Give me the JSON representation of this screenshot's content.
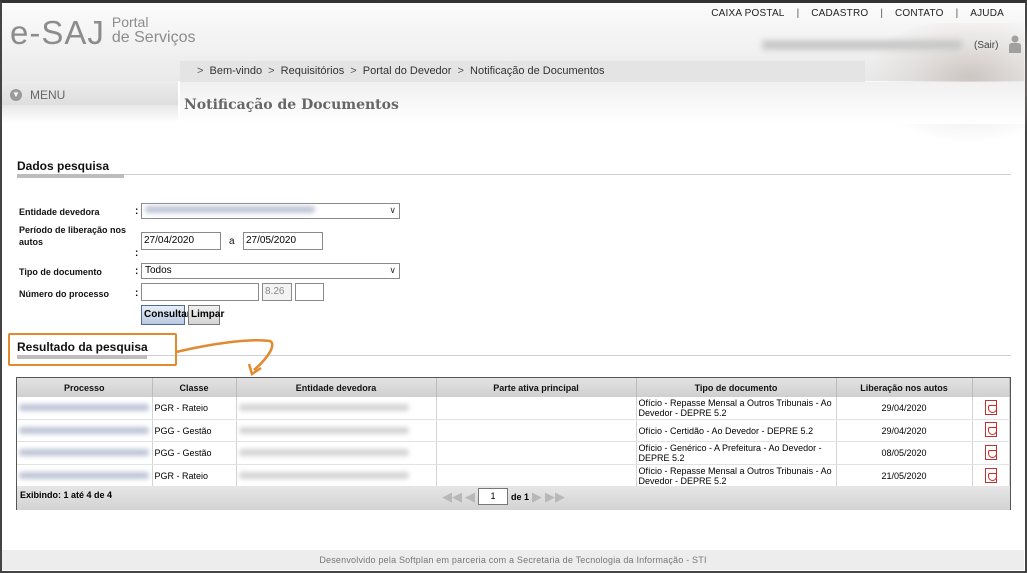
{
  "header": {
    "logo_main": "e-SAJ",
    "logo_sub1": "Portal",
    "logo_sub2": "de Serviços",
    "top_menu": [
      "CAIXA POSTAL",
      "CADASTRO",
      "CONTATO",
      "AJUDA"
    ],
    "sair": "(Sair)"
  },
  "breadcrumb": [
    "Bem-vindo",
    "Requisitórios",
    "Portal do Devedor",
    "Notificação de Documentos"
  ],
  "menu_label": "MENU",
  "page_title": "Notificação de Documentos",
  "dados": {
    "title": "Dados pesquisa",
    "entidade_label": "Entidade devedora",
    "periodo_label": "Período de liberação nos autos",
    "data_inicio": "27/04/2020",
    "a_label": "a",
    "data_fim": "27/05/2020",
    "tipo_label": "Tipo de documento",
    "tipo_value": "Todos",
    "numero_label": "Número do processo",
    "numero_mid": "8.26",
    "btn_consultar": "Consultar",
    "btn_limpar": "Limpar"
  },
  "resultado": {
    "title": "Resultado da pesquisa",
    "columns": [
      "Processo",
      "Classe",
      "Entidade devedora",
      "Parte ativa principal",
      "Tipo de documento",
      "Liberação nos autos"
    ],
    "rows": [
      {
        "classe": "PGR - Rateio",
        "tipo": "Ofício - Repasse Mensal a Outros Tribunais - Ao Devedor - DEPRE 5.2",
        "data": "29/04/2020"
      },
      {
        "classe": "PGG - Gestão",
        "tipo": "Ofício - Certidão - Ao Devedor - DEPRE 5.2",
        "data": "29/04/2020"
      },
      {
        "classe": "PGG - Gestão",
        "tipo": "Ofício - Genérico - A Prefeitura - Ao Devedor - DEPRE 5.2",
        "data": "08/05/2020"
      },
      {
        "classe": "PGR - Rateio",
        "tipo": "Ofício - Repasse Mensal a Outros Tribunais - Ao Devedor - DEPRE 5.2",
        "data": "21/05/2020"
      }
    ],
    "exibindo": "Exibindo: 1 até 4 de 4",
    "page_value": "1",
    "page_of": "de 1"
  },
  "footer": "Desenvolvido pela Softplan em parceria com a Secretaria de Tecnologia da Informação - STI"
}
